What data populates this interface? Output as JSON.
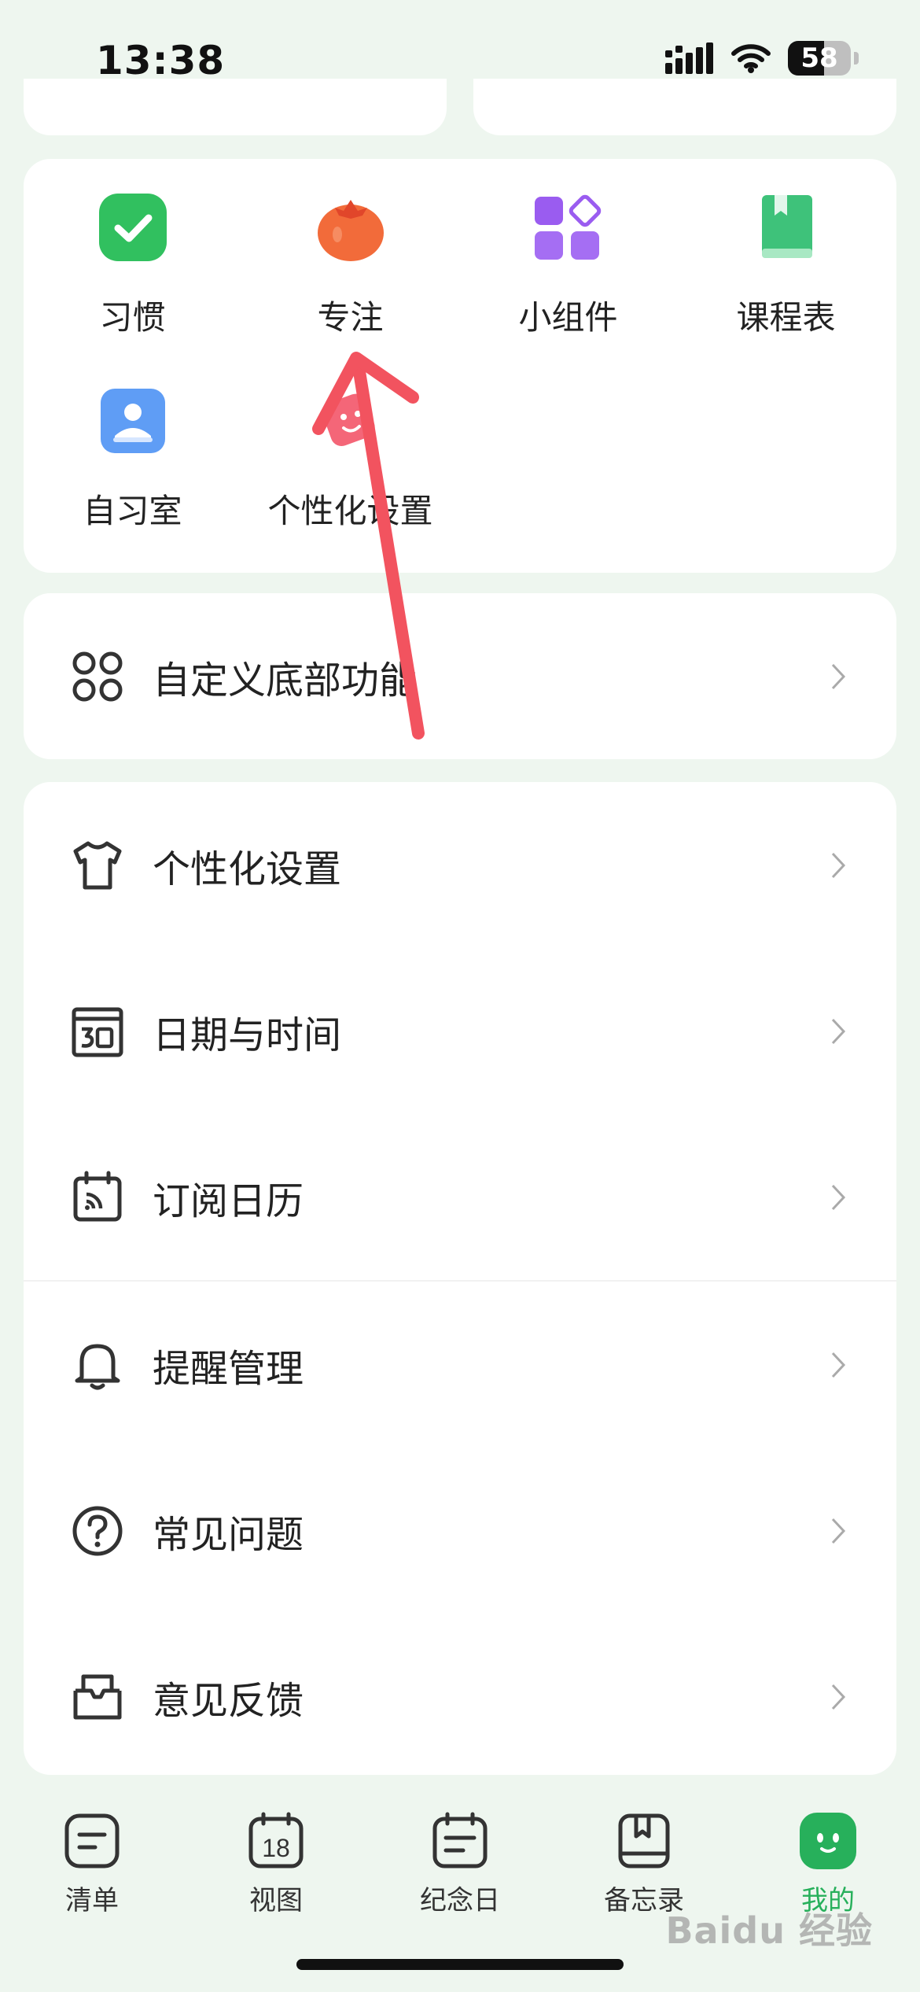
{
  "status_bar": {
    "time": "13:38",
    "battery": "58"
  },
  "apps": [
    {
      "label": "习惯",
      "icon": "habit-check-icon"
    },
    {
      "label": "专注",
      "icon": "tomato-focus-icon"
    },
    {
      "label": "小组件",
      "icon": "widgets-icon"
    },
    {
      "label": "课程表",
      "icon": "course-book-icon"
    },
    {
      "label": "自习室",
      "icon": "study-room-icon"
    },
    {
      "label": "个性化设置",
      "icon": "personalize-tag-icon"
    }
  ],
  "custom_bottom": {
    "label": "自定义底部功能",
    "icon": "four-circles-icon"
  },
  "settings": [
    {
      "label": "个性化设置",
      "icon": "shirt-icon"
    },
    {
      "label": "日期与时间",
      "icon": "calendar-30-icon"
    },
    {
      "label": "订阅日历",
      "icon": "subscribe-calendar-icon"
    }
  ],
  "support": [
    {
      "label": "提醒管理",
      "icon": "bell-icon"
    },
    {
      "label": "常见问题",
      "icon": "question-icon"
    },
    {
      "label": "意见反馈",
      "icon": "feedback-box-icon"
    }
  ],
  "tabs": [
    {
      "label": "清单",
      "icon": "list-icon"
    },
    {
      "label": "视图",
      "icon": "calendar-18-icon",
      "day": "18"
    },
    {
      "label": "纪念日",
      "icon": "anniversary-icon"
    },
    {
      "label": "备忘录",
      "icon": "memo-book-icon"
    },
    {
      "label": "我的",
      "icon": "me-face-icon",
      "active": true
    }
  ],
  "watermark": "Baidu 经验",
  "colors": {
    "accent": "#27b05b",
    "background": "#eef6ef",
    "annotation_arrow": "#f2535f"
  }
}
